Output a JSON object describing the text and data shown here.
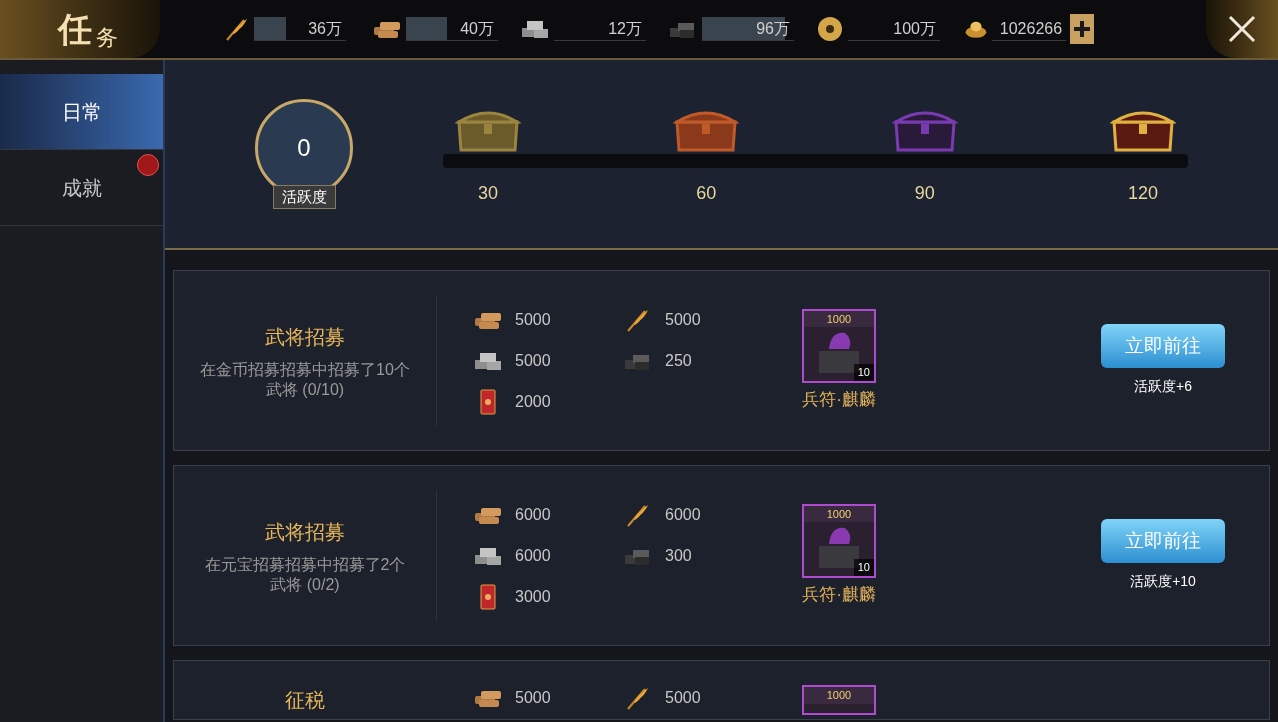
{
  "window": {
    "title_chars": [
      "任",
      "务"
    ]
  },
  "resources": [
    {
      "kind": "grain",
      "value": "36万",
      "level": 0.35
    },
    {
      "kind": "wood",
      "value": "40万",
      "level": 0.45
    },
    {
      "kind": "stone",
      "value": "12万"
    },
    {
      "kind": "iron",
      "value": "96万",
      "level": 0.9
    },
    {
      "kind": "coin",
      "value": "100万"
    },
    {
      "kind": "ingot",
      "value": "1026266"
    }
  ],
  "sidebar": {
    "items": [
      {
        "label": "日常",
        "selected": true,
        "badge": false
      },
      {
        "label": "成就",
        "selected": false,
        "badge": true
      }
    ]
  },
  "activity": {
    "score": "0",
    "label": "活跃度",
    "chests": [
      {
        "kind": "wood",
        "threshold": "30"
      },
      {
        "kind": "red",
        "threshold": "60"
      },
      {
        "kind": "purple",
        "threshold": "90"
      },
      {
        "kind": "gold",
        "threshold": "120"
      }
    ]
  },
  "tasks": [
    {
      "title": "武将招募",
      "description": "在金币招募招募中招募了10个武将 (0/10)",
      "rewards": [
        {
          "kind": "wood",
          "amount": "5000"
        },
        {
          "kind": "grain",
          "amount": "5000"
        },
        {
          "kind": "stone",
          "amount": "5000"
        },
        {
          "kind": "iron",
          "amount": "250"
        },
        {
          "kind": "token",
          "amount": "2000"
        }
      ],
      "item": {
        "value": "1000",
        "count": "10",
        "name": "兵符·麒麟"
      },
      "button": "立即前往",
      "points": "活跃度+6"
    },
    {
      "title": "武将招募",
      "description": "在元宝招募招募中招募了2个武将 (0/2)",
      "rewards": [
        {
          "kind": "wood",
          "amount": "6000"
        },
        {
          "kind": "grain",
          "amount": "6000"
        },
        {
          "kind": "stone",
          "amount": "6000"
        },
        {
          "kind": "iron",
          "amount": "300"
        },
        {
          "kind": "token",
          "amount": "3000"
        }
      ],
      "item": {
        "value": "1000",
        "count": "10",
        "name": "兵符·麒麟"
      },
      "button": "立即前往",
      "points": "活跃度+10"
    },
    {
      "title": "征税",
      "rewards": [
        {
          "kind": "wood",
          "amount": "5000"
        },
        {
          "kind": "grain",
          "amount": "5000"
        }
      ],
      "item": {
        "value": "1000"
      }
    }
  ]
}
